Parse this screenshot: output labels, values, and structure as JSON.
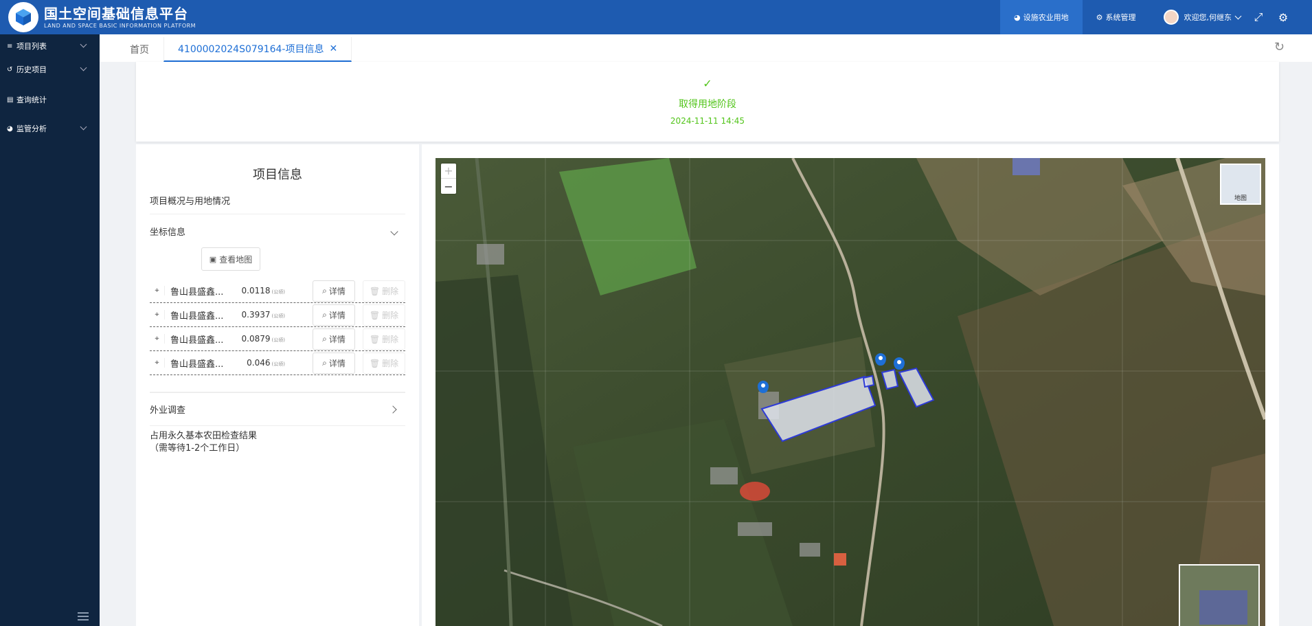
{
  "header": {
    "title_cn": "国土空间基础信息平台",
    "title_en": "LAND AND SPACE BASIC INFORMATION PLATFORM",
    "nav": [
      {
        "label": "设施农业用地",
        "icon": "pie-chart-icon",
        "active": true
      },
      {
        "label": "系统管理",
        "icon": "gears-icon",
        "active": false
      }
    ],
    "user_greeting": "欢迎您,何继东"
  },
  "sidebar": {
    "items": [
      {
        "label": "项目列表",
        "icon": "list-icon",
        "has_children": true
      },
      {
        "label": "历史项目",
        "icon": "history-icon",
        "has_children": true
      },
      {
        "label": "查询统计",
        "icon": "bar-chart-icon",
        "has_children": false
      },
      {
        "label": "监管分析",
        "icon": "pie-chart-icon",
        "has_children": true
      }
    ]
  },
  "tabs": {
    "home": "首页",
    "active": "4100002024S079164-项目信息"
  },
  "status": {
    "title": "取得用地阶段",
    "time": "2024-11-11 14:45",
    "color": "#52c41a"
  },
  "info": {
    "title": "项目信息",
    "overview": "项目概况与用地情况",
    "coords_section": "坐标信息",
    "view_map": "查看地图",
    "coords": [
      {
        "name": "鲁山县盛鑫...",
        "value": "0.0118",
        "unit": "(公顷)"
      },
      {
        "name": "鲁山县盛鑫...",
        "value": "0.3937",
        "unit": "(公顷)"
      },
      {
        "name": "鲁山县盛鑫...",
        "value": "0.0879",
        "unit": "(公顷)"
      },
      {
        "name": "鲁山县盛鑫...",
        "value": "0.046",
        "unit": "(公顷)"
      }
    ],
    "detail_label": "详情",
    "delete_label": "删除",
    "field_survey": "外业调查",
    "check_result_line1": "占用永久基本农田检查结果",
    "check_result_line2": "（需等待1-2个工作日）"
  },
  "map": {
    "zoom_in": "+",
    "zoom_out": "−",
    "basemap_label": "地图"
  },
  "colors": {
    "header_bg": "#1e5bb0",
    "sidebar_bg": "#0f2540",
    "accent": "#1e6fd6",
    "parcel_stroke": "#2d3ad8"
  }
}
